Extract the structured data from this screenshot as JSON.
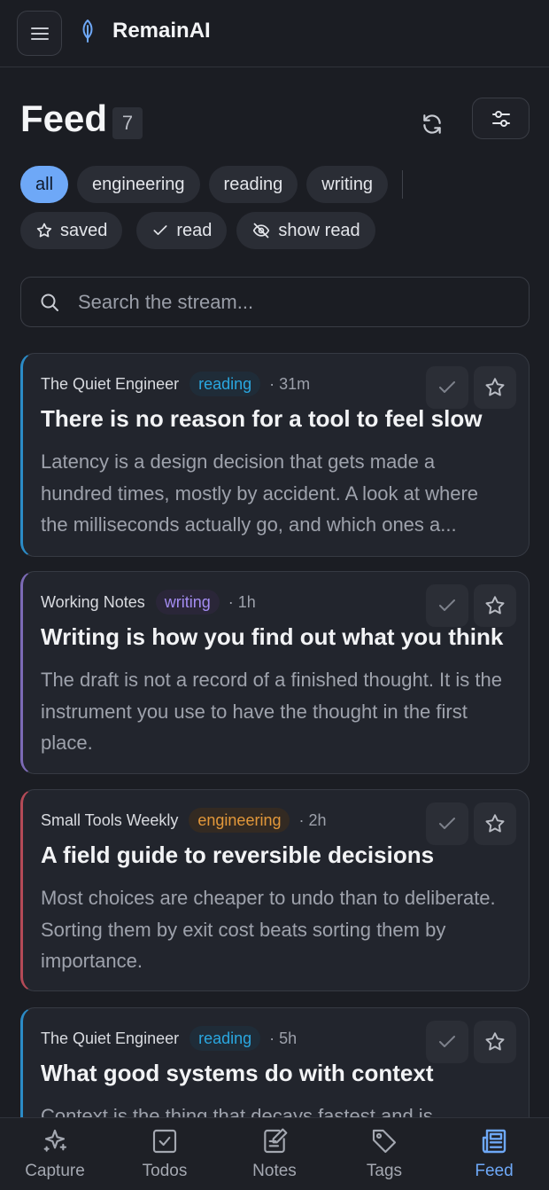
{
  "app": {
    "name": "RemainAI"
  },
  "header": {
    "title": "Feed",
    "count": "7"
  },
  "filters": {
    "topics": [
      {
        "label": "all",
        "active": true
      },
      {
        "label": "engineering",
        "active": false
      },
      {
        "label": "reading",
        "active": false
      },
      {
        "label": "writing",
        "active": false
      }
    ],
    "states": [
      {
        "label": "saved",
        "icon": "star-icon"
      },
      {
        "label": "read",
        "icon": "check-icon"
      },
      {
        "label": "show read",
        "icon": "eye-off-icon"
      }
    ]
  },
  "search": {
    "placeholder": "Search the stream...",
    "value": ""
  },
  "feed": {
    "items": [
      {
        "source": "The Quiet Engineer",
        "tag": "reading",
        "time": "· 31m",
        "title": "There is no reason for a tool to feel slow",
        "excerpt": "Latency is a design decision that gets made a hundred times, mostly by accident. A look at where the milliseconds actually go, and which ones a...",
        "accent": "#2b8bc6"
      },
      {
        "source": "Working Notes",
        "tag": "writing",
        "time": "· 1h",
        "title": "Writing is how you find out what you think",
        "excerpt": "The draft is not a record of a finished thought. It is the instrument you use to have the thought in the first place.",
        "accent": "#7c6ab5"
      },
      {
        "source": "Small Tools Weekly",
        "tag": "engineering",
        "time": "· 2h",
        "title": "A field guide to reversible decisions",
        "excerpt": "Most choices are cheaper to undo than to deliberate. Sorting them by exit cost beats sorting them by importance.",
        "accent": "#b44a57"
      },
      {
        "source": "The Quiet Engineer",
        "tag": "reading",
        "time": "· 5h",
        "title": "What good systems do with context",
        "excerpt": "Context is the thing that decays fastest and is",
        "accent": "#2b8bc6"
      }
    ]
  },
  "nav": {
    "items": [
      {
        "label": "Capture",
        "icon": "sparkle-icon",
        "active": false
      },
      {
        "label": "Todos",
        "icon": "checkbox-icon",
        "active": false
      },
      {
        "label": "Notes",
        "icon": "note-edit-icon",
        "active": false
      },
      {
        "label": "Tags",
        "icon": "tag-icon",
        "active": false
      },
      {
        "label": "Feed",
        "icon": "newspaper-icon",
        "active": true
      }
    ]
  },
  "colors": {
    "background": "#1b1d23",
    "accent": "#6ea8f7",
    "reading": "#2aa7e0",
    "writing": "#a48df2",
    "engineering": "#e3983a"
  }
}
